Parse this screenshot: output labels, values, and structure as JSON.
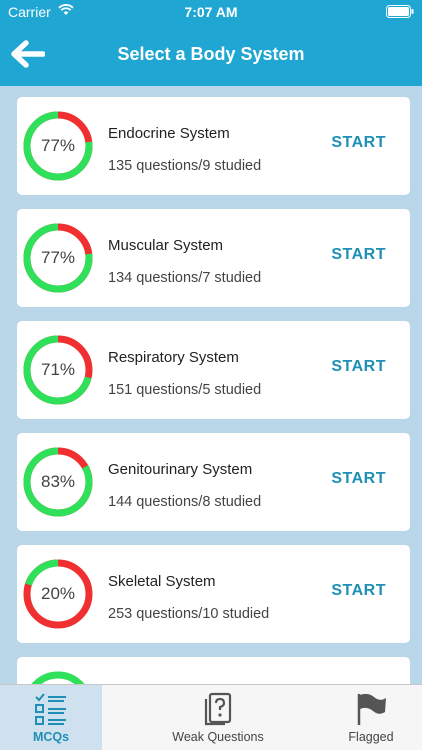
{
  "status_bar": {
    "carrier": "Carrier",
    "time": "7:07 AM"
  },
  "nav": {
    "title": "Select a Body System",
    "back_icon": "arrow-left-icon"
  },
  "colors": {
    "brand": "#1fa6d3",
    "accent": "#1f8fb6",
    "ring_done": "#2ee05a",
    "ring_remaining": "#f03030"
  },
  "systems": [
    {
      "name": "Endocrine System",
      "stats": "135 questions/9 studied",
      "percent_label": "77%",
      "progress": 0.77,
      "action": "START"
    },
    {
      "name": "Muscular System",
      "stats": "134 questions/7 studied",
      "percent_label": "77%",
      "progress": 0.77,
      "action": "START"
    },
    {
      "name": "Respiratory System",
      "stats": "151 questions/5 studied",
      "percent_label": "71%",
      "progress": 0.71,
      "action": "START"
    },
    {
      "name": "Genitourinary System",
      "stats": "144 questions/8 studied",
      "percent_label": "83%",
      "progress": 0.83,
      "action": "START"
    },
    {
      "name": "Skeletal System",
      "stats": "253 questions/10 studied",
      "percent_label": "20%",
      "progress": 0.2,
      "action": "START"
    }
  ],
  "tabs": [
    {
      "label": "MCQs",
      "icon": "checklist-icon",
      "active": true
    },
    {
      "label": "Weak Questions",
      "icon": "question-document-icon",
      "active": false
    },
    {
      "label": "Flagged",
      "icon": "flag-icon",
      "active": false
    }
  ]
}
